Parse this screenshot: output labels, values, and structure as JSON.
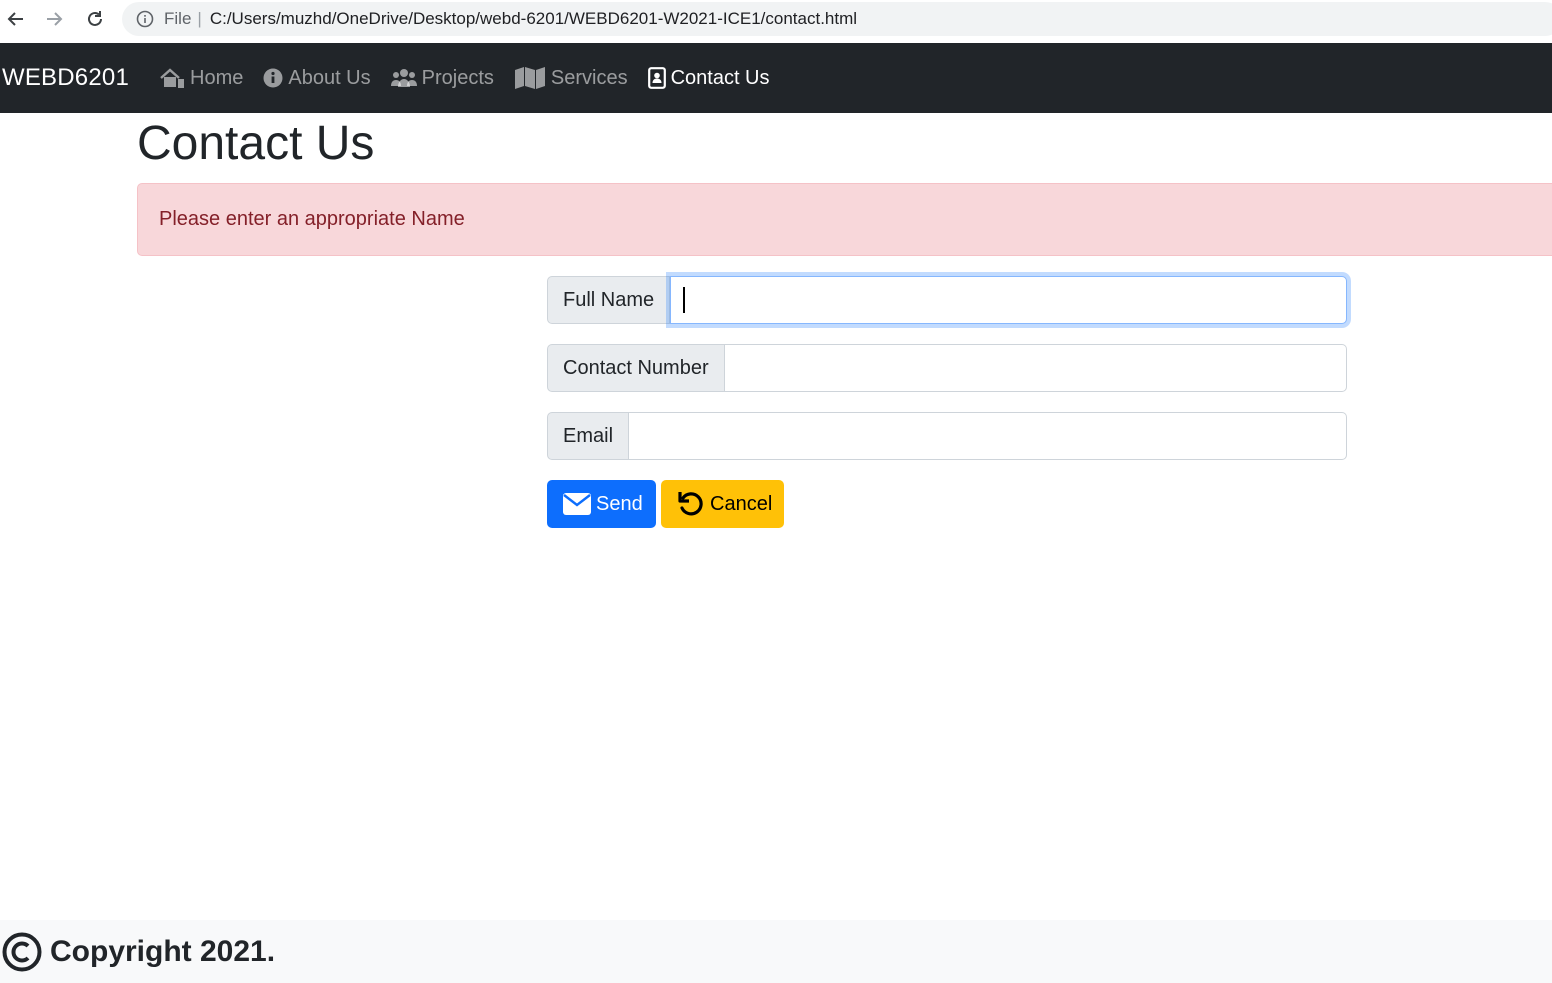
{
  "browser": {
    "file_label": "File",
    "separator": "|",
    "url": "C:/Users/muzhd/OneDrive/Desktop/webd-6201/WEBD6201-W2021-ICE1/contact.html"
  },
  "navbar": {
    "brand": "WEBD6201",
    "items": [
      {
        "label": "Home",
        "icon": "home-icon",
        "active": false
      },
      {
        "label": "About Us",
        "icon": "info-circle-icon",
        "active": false
      },
      {
        "label": "Projects",
        "icon": "users-cog-icon",
        "active": false
      },
      {
        "label": "Services",
        "icon": "map-icon",
        "active": false
      },
      {
        "label": "Contact Us",
        "icon": "contact-book-icon",
        "active": true
      }
    ]
  },
  "page": {
    "title": "Contact Us",
    "alert_message": "Please enter an appropriate Name"
  },
  "form": {
    "full_name_label": "Full Name",
    "full_name_value": "",
    "contact_number_label": "Contact Number",
    "contact_number_value": "",
    "email_label": "Email",
    "email_value": "",
    "send_label": "Send",
    "cancel_label": "Cancel"
  },
  "footer": {
    "copyright": "Copyright 2021."
  },
  "colors": {
    "navbar_bg": "#212529",
    "alert_bg": "#f8d7da",
    "alert_text": "#842029",
    "send_bg": "#0d6efd",
    "cancel_bg": "#ffc107",
    "footer_bg": "#f8f9fa"
  }
}
